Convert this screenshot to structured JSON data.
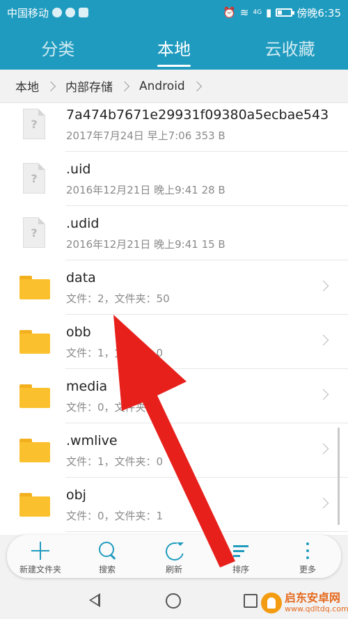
{
  "status_bar": {
    "carrier": "中国移动",
    "network": "4G",
    "time": "傍晚6:35"
  },
  "tabs": [
    {
      "label": "分类",
      "active": false
    },
    {
      "label": "本地",
      "active": true
    },
    {
      "label": "云收藏",
      "active": false
    }
  ],
  "breadcrumb": [
    "本地",
    "内部存储",
    "Android"
  ],
  "items": [
    {
      "type": "file",
      "name": "7a474b7671e29931f09380a5ecbae543",
      "meta": "2017年7月24日 早上7:06 353 B",
      "icon": "unknown-file-icon",
      "glyph": "?"
    },
    {
      "type": "file",
      "name": ".uid",
      "meta": "2016年12月21日 晚上9:41 28 B",
      "icon": "unknown-file-icon",
      "glyph": "?"
    },
    {
      "type": "file",
      "name": ".udid",
      "meta": "2016年12月21日 晚上9:41 15 B",
      "icon": "unknown-file-icon",
      "glyph": "?"
    },
    {
      "type": "folder",
      "name": "data",
      "meta": "文件：2，文件夹：50",
      "icon": "folder-icon"
    },
    {
      "type": "folder",
      "name": "obb",
      "meta": "文件：1，文件夹：0",
      "icon": "folder-icon"
    },
    {
      "type": "folder",
      "name": "media",
      "meta": "文件：0，文件夹：1",
      "icon": "folder-icon"
    },
    {
      "type": "folder",
      "name": ".wmlive",
      "meta": "文件：1，文件夹：0",
      "icon": "folder-icon"
    },
    {
      "type": "folder",
      "name": "obj",
      "meta": "文件：0，文件夹：1",
      "icon": "folder-icon"
    }
  ],
  "toolbar": [
    {
      "label": "新建文件夹",
      "icon": "plus-icon"
    },
    {
      "label": "搜索",
      "icon": "search-icon"
    },
    {
      "label": "刷新",
      "icon": "refresh-icon"
    },
    {
      "label": "排序",
      "icon": "sort-icon"
    },
    {
      "label": "更多",
      "icon": "more-icon"
    }
  ],
  "watermark": {
    "title": "启东安卓网",
    "url": "www.qdltdq.com"
  },
  "colors": {
    "accent": "#1f9bbf",
    "folder": "#fbc02d",
    "annotation_arrow": "#e8201c"
  }
}
